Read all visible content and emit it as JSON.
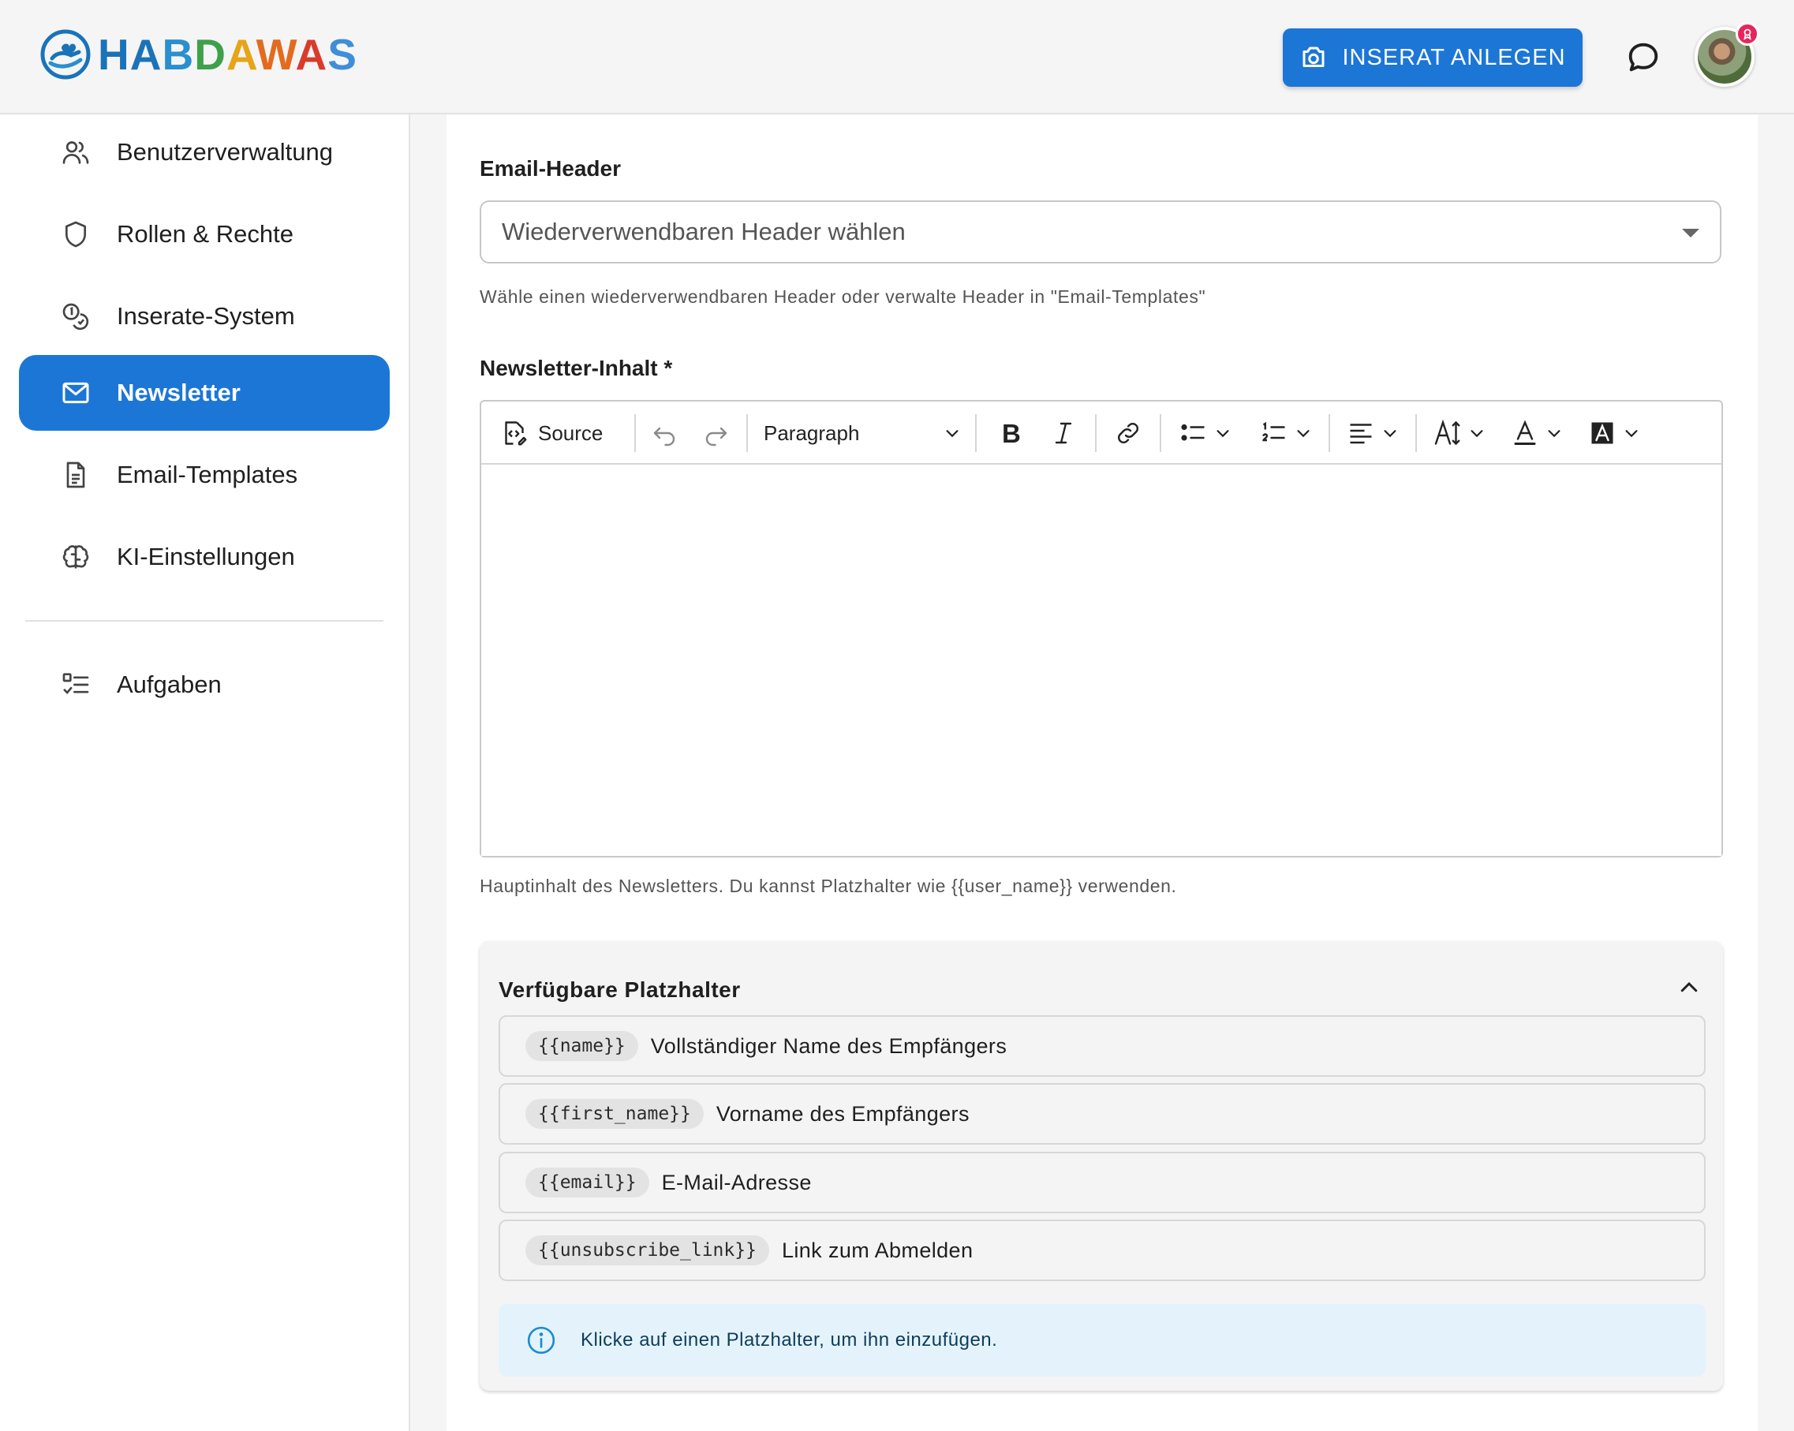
{
  "brand": {
    "logo_letters": [
      "H",
      "A",
      "B",
      "D",
      "A",
      "W",
      "A",
      "S"
    ]
  },
  "header": {
    "cta_label": "INSERAT ANLEGEN",
    "cta_icon": "camera-icon",
    "chat_icon": "chat-bubble-icon",
    "avatar_badge_icon": "award-icon",
    "accent_color": "#1c76d6"
  },
  "sidebar": {
    "items": [
      {
        "label": "Benutzerverwaltung",
        "icon": "users-icon",
        "active": false
      },
      {
        "label": "Rollen & Rechte",
        "icon": "shield-icon",
        "active": false
      },
      {
        "label": "Inserate-System",
        "icon": "coins-icon",
        "active": false
      },
      {
        "label": "Newsletter",
        "icon": "mail-icon",
        "active": true
      },
      {
        "label": "Email-Templates",
        "icon": "document-icon",
        "active": false
      },
      {
        "label": "KI-Einstellungen",
        "icon": "brain-icon",
        "active": false
      }
    ],
    "secondary": [
      {
        "label": "Aufgaben",
        "icon": "tasks-icon",
        "active": false
      }
    ]
  },
  "form": {
    "email_header": {
      "label": "Email-Header",
      "placeholder": "Wiederverwendbaren Header wählen",
      "helper": "Wähle einen wiederverwendbaren Header oder verwalte Header in \"Email-Templates\""
    },
    "content": {
      "label": "Newsletter-Inhalt *",
      "helper": "Hauptinhalt des Newsletters. Du kannst Platzhalter wie {{user_name}} verwenden.",
      "value": ""
    },
    "toolbar": {
      "source_label": "Source",
      "block_format": "Paragraph",
      "buttons": [
        "undo-icon",
        "redo-icon",
        "bold-icon",
        "italic-icon",
        "link-icon",
        "bulleted-list-icon",
        "numbered-list-icon",
        "align-left-icon",
        "font-size-icon",
        "font-color-icon",
        "background-color-icon"
      ]
    }
  },
  "placeholders": {
    "title": "Verfügbare Platzhalter",
    "expanded": true,
    "items": [
      {
        "token": "{{name}}",
        "description": "Vollständiger Name des Empfängers"
      },
      {
        "token": "{{first_name}}",
        "description": "Vorname des Empfängers"
      },
      {
        "token": "{{email}}",
        "description": "E-Mail-Adresse"
      },
      {
        "token": "{{unsubscribe_link}}",
        "description": "Link zum Abmelden"
      }
    ],
    "info": "Klicke auf einen Platzhalter, um ihn einzufügen."
  }
}
